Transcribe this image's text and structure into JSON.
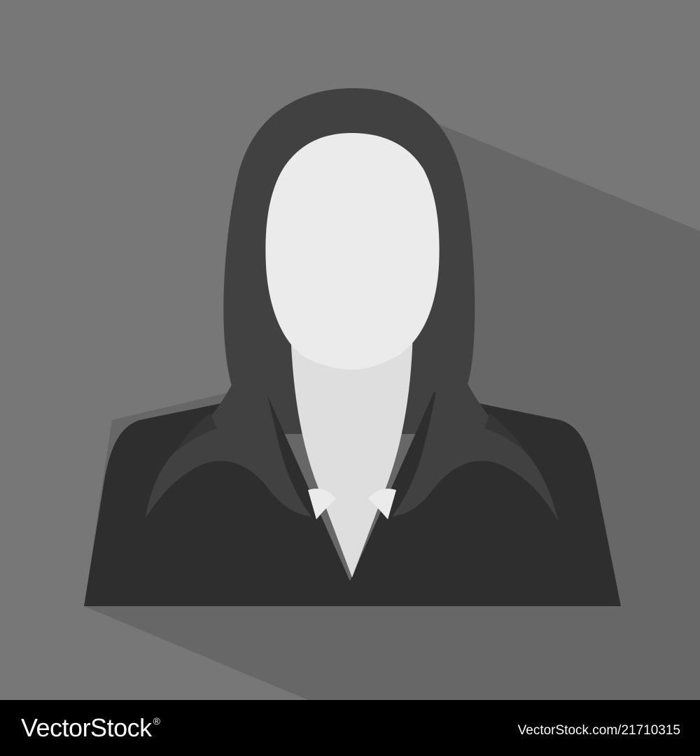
{
  "illustration": {
    "subject": "female-avatar-placeholder-icon",
    "colors": {
      "background": "#777777",
      "long_shadow": "#676767",
      "hair": "#414141",
      "hair_shade": "#363636",
      "jacket": "#2e2e2e",
      "face": "#ebebeb",
      "neck": "#dedede",
      "collar": "#ebebeb"
    }
  },
  "footer": {
    "brand": "VectorStock",
    "brand_mark": "®",
    "image_id": "VectorStock.com/21710315"
  }
}
